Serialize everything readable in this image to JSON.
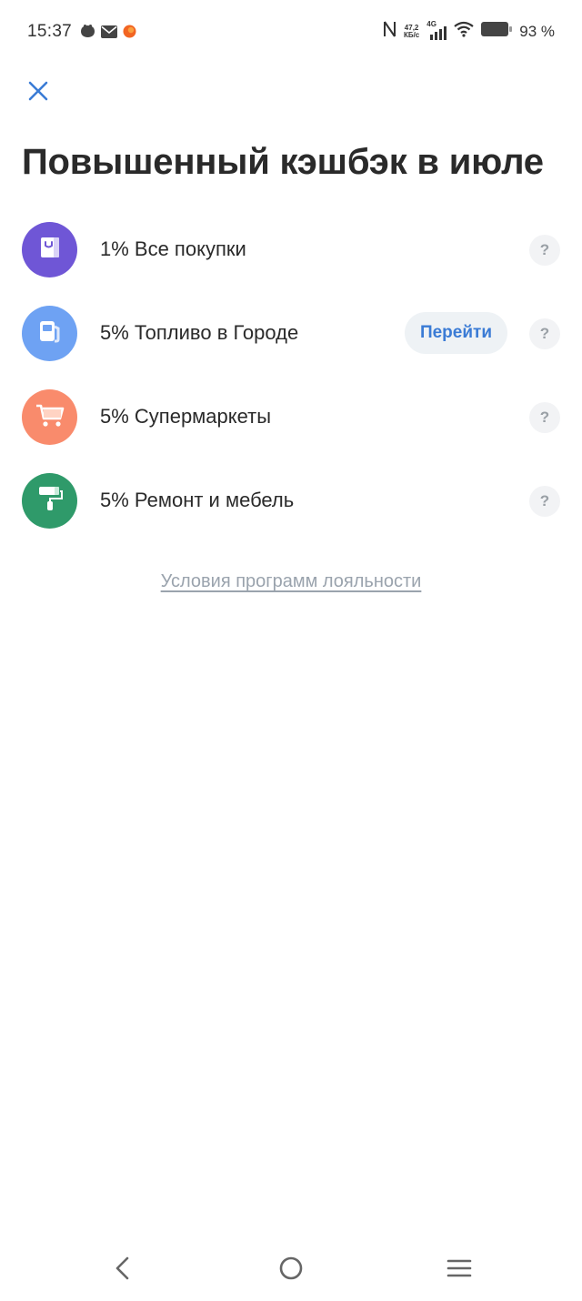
{
  "status_bar": {
    "time": "15:37",
    "network_speed_value": "47,2",
    "network_speed_unit": "КБ/с",
    "network_type": "4G",
    "battery_percent": "93 %",
    "left_icons": [
      "vk-icon",
      "mail-icon",
      "orange-app-icon"
    ],
    "right_icons": [
      "nfc-icon",
      "signal-icon",
      "wifi-icon",
      "battery-icon"
    ]
  },
  "header": {
    "close_icon": "close-icon",
    "title": "Повышенный кэшбэк в июле"
  },
  "cashback": {
    "items": [
      {
        "label": "1% Все покупки",
        "icon": "shopping-bag-icon",
        "color": "#6f56d6",
        "action": null,
        "help": "?"
      },
      {
        "label": "5% Топливо в Городе",
        "icon": "fuel-pump-icon",
        "color": "#6ea2f3",
        "action": "Перейти",
        "help": "?"
      },
      {
        "label": "5% Супермаркеты",
        "icon": "cart-icon",
        "color": "#f98b6c",
        "action": null,
        "help": "?"
      },
      {
        "label": "5% Ремонт и мебель",
        "icon": "paint-roller-icon",
        "color": "#2f9a6a",
        "action": null,
        "help": "?"
      }
    ]
  },
  "footer": {
    "loyalty_link": "Условия программ лояльности"
  },
  "nav_bar": {
    "icons": [
      "back-icon",
      "home-icon",
      "menu-icon"
    ]
  },
  "colors": {
    "accent": "#3a7bd5",
    "close": "#3a7bd5",
    "link_muted": "#9aa3ad"
  }
}
